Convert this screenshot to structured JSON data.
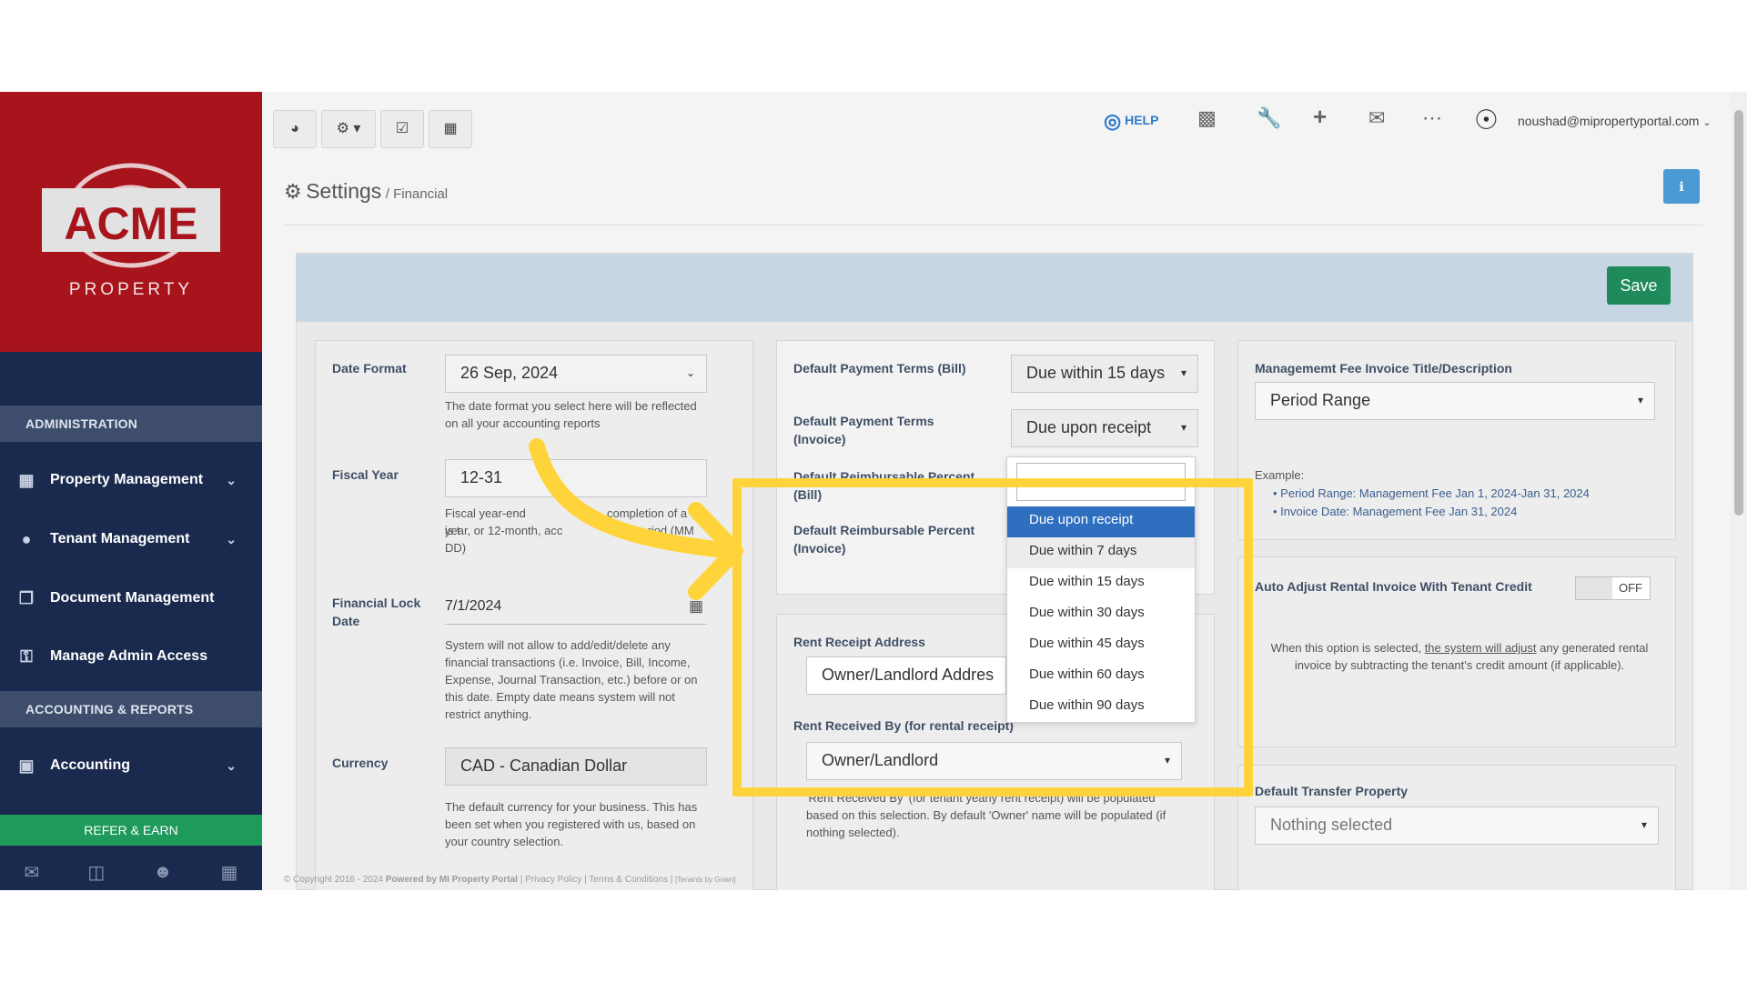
{
  "logo": {
    "brand": "ACME",
    "tagline": "PROPERTY",
    "bg_color": "#a8141c"
  },
  "sidebar": {
    "sections": [
      {
        "label": "ADMINISTRATION"
      },
      {
        "label": "ACCOUNTING & REPORTS"
      }
    ],
    "items": [
      {
        "label": "Property Management",
        "icon": "building-icon",
        "has_chevron": true
      },
      {
        "label": "Tenant Management",
        "icon": "users-icon",
        "has_chevron": true
      },
      {
        "label": "Document Management",
        "icon": "documents-icon",
        "has_chevron": false
      },
      {
        "label": "Manage Admin Access",
        "icon": "key-icon",
        "has_chevron": false
      },
      {
        "label": "Accounting",
        "icon": "money-icon",
        "has_chevron": true
      }
    ],
    "refer_label": "REFER & EARN",
    "bottom_icons": [
      "mail-icon",
      "briefcase-icon",
      "user-icon",
      "calculator-icon"
    ]
  },
  "topbar": {
    "help_label": "HELP",
    "user_email": "noushad@mipropertyportal.com"
  },
  "page": {
    "title": "Settings",
    "subtitle": "/ Financial",
    "save_label": "Save"
  },
  "left_card": {
    "date_format_label": "Date Format",
    "date_format_value": "26 Sep, 2024",
    "date_format_help": "The date format you select here will be reflected on all your accounting reports",
    "fiscal_year_label": "Fiscal Year",
    "fiscal_year_value": "12-31",
    "fiscal_year_help_1": "Fiscal year-end is t",
    "fiscal_year_help_1b": "completion of a o",
    "fiscal_year_help_2": "year, or 12-month, acc",
    "fiscal_year_help_2b": "period (MM",
    "fiscal_year_help_3": "DD)",
    "lock_label": "Financial Lock Date",
    "lock_value": "7/1/2024",
    "lock_help": "System will not allow to add/edit/delete any financial transactions (i.e. Invoice, Bill, Income, Expense, Journal Transaction, etc.) before or on this date. Empty date means system will not restrict anything.",
    "currency_label": "Currency",
    "currency_value": "CAD - Canadian Dollar",
    "currency_help": "The default currency for your business. This has been set when you registered with us, based on your country selection."
  },
  "middle_card": {
    "terms_bill_label": "Default Payment Terms (Bill)",
    "terms_bill_value": "Due within 15 days",
    "terms_invoice_label": "Default Payment Terms (Invoice)",
    "terms_invoice_value": "Due upon receipt",
    "reimb_bill_label": "Default Reimbursable Percent (Bill)",
    "reimb_invoice_label": "Default Reimbursable Percent (Invoice)",
    "rent_receipt_label": "Rent Receipt Address",
    "rent_receipt_value": "Owner/Landlord Addres",
    "rent_received_label": "Rent Received By (for rental receipt)",
    "rent_received_value": "Owner/Landlord",
    "rent_received_help": "'Rent Received By' (for tenant yearly rent receipt) will be populated based on this selection. By default 'Owner' name will be populated (if nothing selected)."
  },
  "dropdown": {
    "search_placeholder": "",
    "options": [
      {
        "label": "Due upon receipt",
        "state": "selected"
      },
      {
        "label": "Due within 7 days",
        "state": "hover"
      },
      {
        "label": "Due within 15 days",
        "state": "normal"
      },
      {
        "label": "Due within 30 days",
        "state": "normal"
      },
      {
        "label": "Due within 45 days",
        "state": "normal"
      },
      {
        "label": "Due within 60 days",
        "state": "normal"
      },
      {
        "label": "Due within 90 days",
        "state": "normal"
      }
    ]
  },
  "right_card": {
    "fee_title_label": "Managememt Fee Invoice Title/Description",
    "fee_title_value": "Period Range",
    "example_label": "Example:",
    "example_1_key": "Period Range: ",
    "example_1_val": "Management Fee Jan 1, 2024-Jan 31, 2024",
    "example_2_key": "Invoice Date: ",
    "example_2_val": "Management Fee Jan 31, 2024",
    "auto_adjust_label": "Auto Adjust Rental Invoice With Tenant Credit",
    "toggle_state": "OFF",
    "auto_adjust_help_1": "When this option is selected, ",
    "auto_adjust_help_link": "the system will adjust",
    "auto_adjust_help_2": " any generated rental invoice by subtracting the tenant's credit amount (if applicable).",
    "transfer_label": "Default Transfer Property",
    "transfer_value": "Nothing selected"
  },
  "footer": {
    "copyright": "© Copyright 2016 - 2024",
    "powered": "Powered by MI Property Portal",
    "links": "| Privacy Policy | Terms & Conditions |",
    "small": "[Tenants by Gowri]"
  },
  "colors": {
    "sidebar_bg": "#1a2a4e",
    "highlight": "#ffd43b",
    "save_green": "#1f8b5a",
    "select_blue": "#2e6fc0"
  }
}
